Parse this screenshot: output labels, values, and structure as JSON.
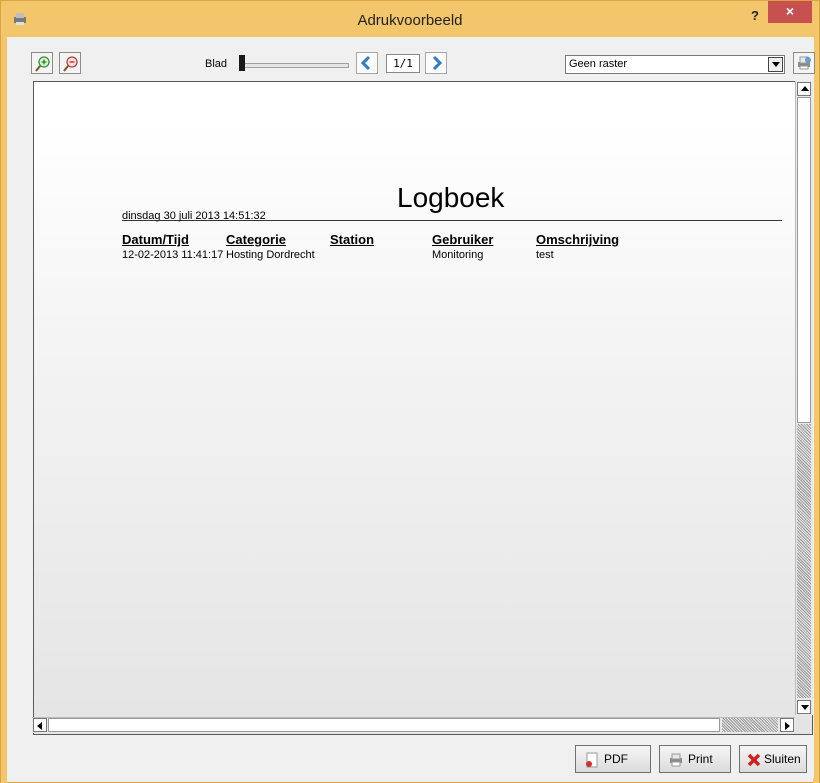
{
  "window": {
    "title": "Adrukvoorbeeld",
    "help": "?",
    "close": "×"
  },
  "toolbar": {
    "zoom_in_icon": "zoom-in-icon",
    "zoom_out_icon": "zoom-out-icon",
    "page_label": "Blad",
    "page_indicator": "1/1",
    "raster_selected": "Geen raster"
  },
  "report": {
    "title": "Logboek",
    "date": "dinsdag 30 juli 2013  14:51:32",
    "columns": [
      "Datum/Tijd",
      "Categorie",
      "Station",
      "Gebruiker",
      "Omschrijving"
    ],
    "rows": [
      {
        "datum_tijd": "12-02-2013 11:41:17",
        "categorie": "Hosting Dordrecht",
        "station": "",
        "gebruiker": "Monitoring",
        "omschrijving": "test"
      }
    ]
  },
  "buttons": {
    "pdf": "PDF",
    "print": "Print",
    "close": "Sluiten"
  },
  "colors": {
    "titlebar": "#f3c66b",
    "close_button": "#c75050",
    "nav_arrow": "#2f7cc4"
  }
}
